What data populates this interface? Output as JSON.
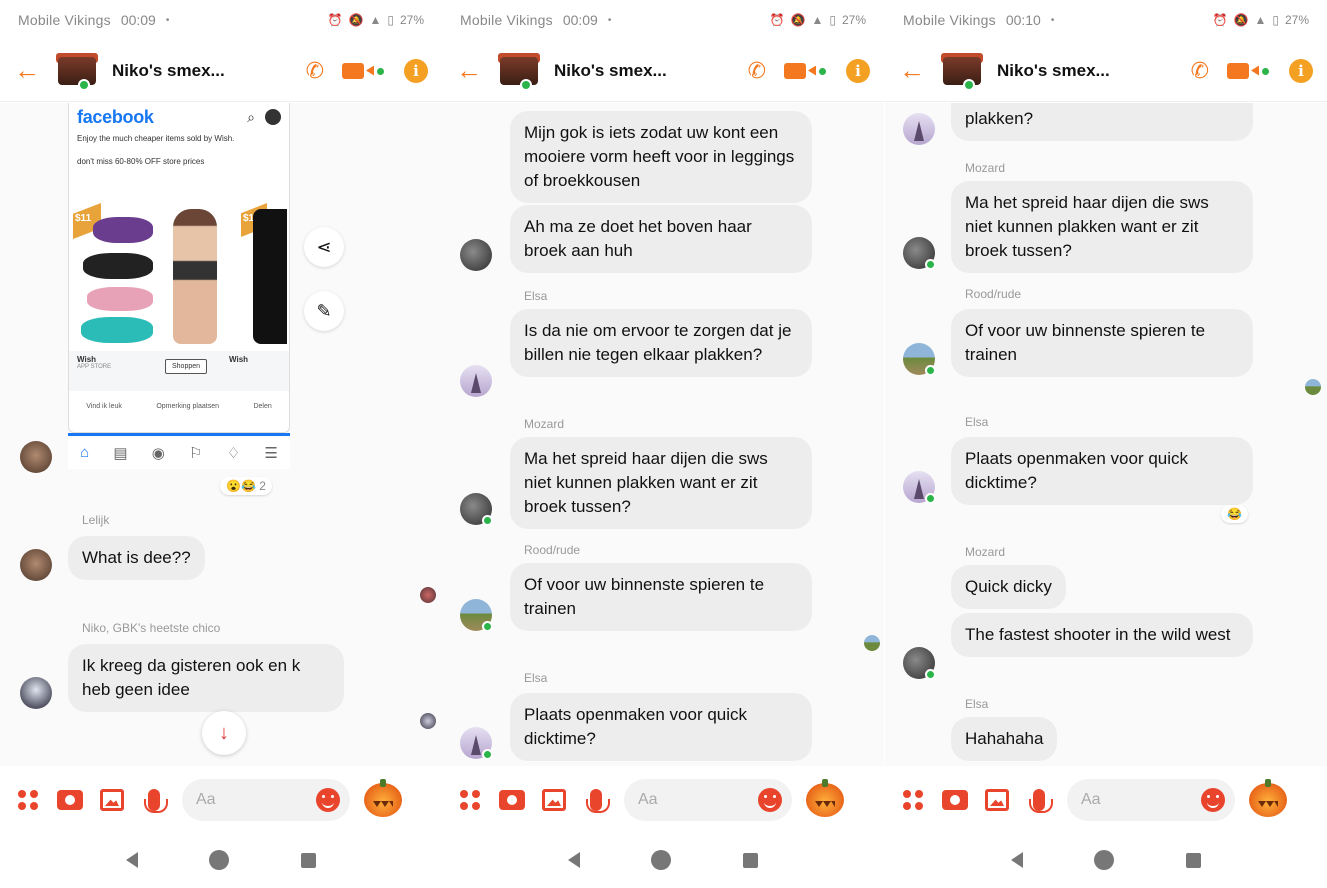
{
  "status": {
    "carrier": "Mobile Vikings",
    "battery": "27%"
  },
  "panels": [
    {
      "time": "00:09",
      "title": "Niko's smex...",
      "fb": {
        "logo": "facebook",
        "ad_text_1": "Enjoy the much cheaper items sold by Wish.",
        "ad_text_2": "don't miss 60-80% OFF store prices",
        "price_1": "$11",
        "price_2": "$1",
        "brand": "Wish",
        "brand_sub": "APP STORE",
        "shop_button": "Shoppen",
        "action_like": "Vind ik leuk",
        "action_comment": "Opmerking plaatsen",
        "action_share": "Delen"
      },
      "reaction_count": "2",
      "messages": {
        "m1_sender": "Lelijk",
        "m1_text": "What is dee??",
        "m2_sender": "Niko, GBK's heetste chico",
        "m2_text": "Ik kreeg da gisteren ook en k heb geen idee"
      },
      "composer_placeholder": "Aa"
    },
    {
      "time": "00:09",
      "title": "Niko's smex...",
      "messages": {
        "m1_text": "Mijn gok is iets zodat uw kont een mooiere vorm heeft voor in leggings of broekkousen",
        "m2_text": "Ah ma ze doet het boven haar broek aan huh",
        "m3_sender": "Elsa",
        "m3_text": "Is da nie om ervoor te zorgen dat je billen nie tegen elkaar plakken?",
        "m4_sender": "Mozard",
        "m4_text": "Ma het spreid haar dijen die sws niet kunnen plakken want er zit broek tussen?",
        "m5_sender": "Rood/rude",
        "m5_text": "Of voor uw binnenste spieren te trainen",
        "m6_sender": "Elsa",
        "m6_text": "Plaats openmaken voor quick dicktime?"
      },
      "composer_placeholder": "Aa"
    },
    {
      "time": "00:10",
      "title": "Niko's smex...",
      "messages": {
        "m1_text": "plakken?",
        "m2_sender": "Mozard",
        "m2_text": "Ma het spreid haar dijen die sws niet kunnen plakken want er zit broek tussen?",
        "m3_sender": "Rood/rude",
        "m3_text": "Of voor uw binnenste spieren te trainen",
        "m4_sender": "Elsa",
        "m4_text": "Plaats openmaken voor quick dicktime?",
        "m5_sender": "Mozard",
        "m5_text": "Quick dicky",
        "m6_text": "The fastest shooter in the wild west",
        "m7_sender": "Elsa",
        "m7_text": "Hahahaha"
      },
      "composer_placeholder": "Aa"
    }
  ],
  "colors": {
    "accent": "#f4781f",
    "composer": "#e8452c",
    "online": "#2ab44a",
    "bubble": "#ededed"
  }
}
